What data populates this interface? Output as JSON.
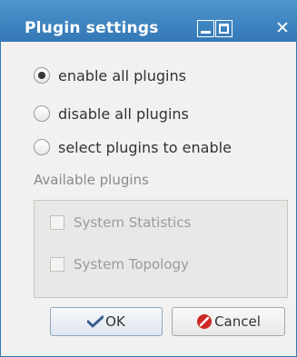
{
  "window": {
    "title": "Plugin settings"
  },
  "options": [
    {
      "label": "enable all plugins",
      "checked": true
    },
    {
      "label": "disable all plugins",
      "checked": false
    },
    {
      "label": "select plugins to enable",
      "checked": false
    }
  ],
  "plugins_group": {
    "label": "Available plugins",
    "items": [
      {
        "label": "System Statistics",
        "checked": false,
        "enabled": false
      },
      {
        "label": "System Topology",
        "checked": false,
        "enabled": false
      }
    ]
  },
  "buttons": {
    "ok": {
      "label": "OK",
      "icon": "checkmark-icon"
    },
    "cancel": {
      "label": "Cancel",
      "icon": "cancel-icon"
    }
  },
  "colors": {
    "titlebar": "#3478b6",
    "window_bg": "#f2f1f0",
    "cancel_icon": "#cc2a22",
    "ok_icon": "#3a5f8f"
  }
}
